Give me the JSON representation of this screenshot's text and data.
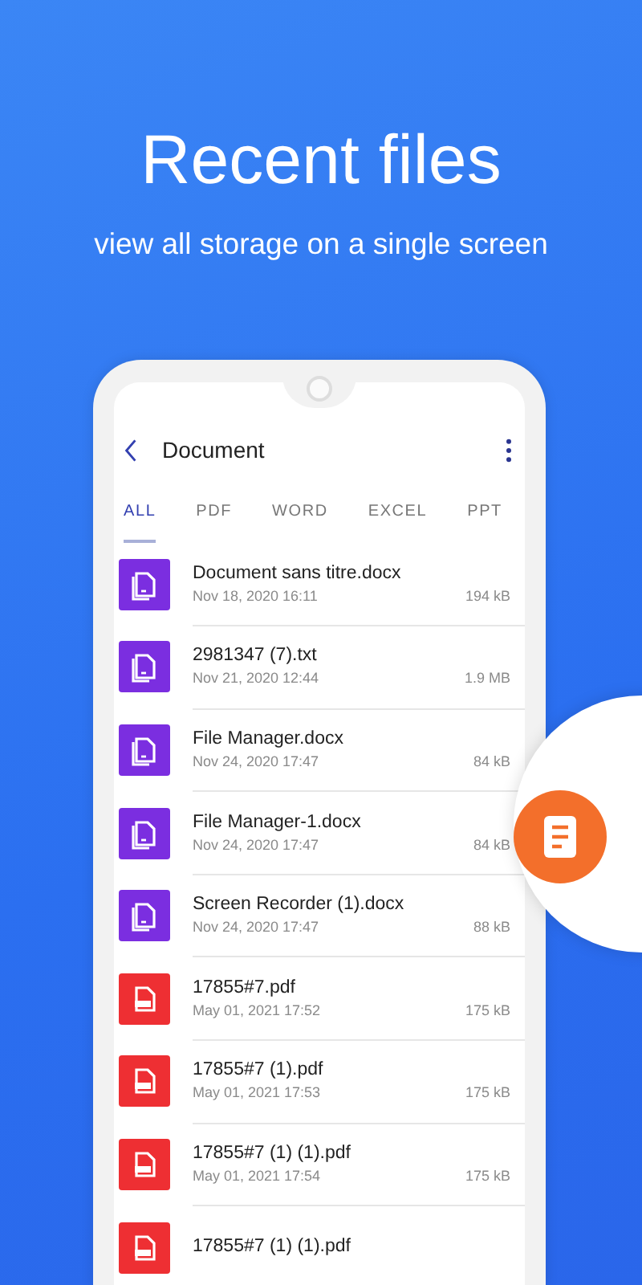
{
  "headline": "Recent files",
  "subtitle": "view all storage on a single screen",
  "header": {
    "title": "Document"
  },
  "tabs": [
    {
      "label": "ALL",
      "selected": true
    },
    {
      "label": "PDF",
      "selected": false
    },
    {
      "label": "WORD",
      "selected": false
    },
    {
      "label": "EXCEL",
      "selected": false
    },
    {
      "label": "PPT",
      "selected": false
    }
  ],
  "files": [
    {
      "kind": "doc",
      "name": "Document sans titre.docx",
      "date": "Nov 18, 2020 16:11",
      "size": "194 kB"
    },
    {
      "kind": "doc",
      "name": "2981347 (7).txt",
      "date": "Nov 21, 2020 12:44",
      "size": "1.9 MB"
    },
    {
      "kind": "doc",
      "name": "File Manager.docx",
      "date": "Nov 24, 2020 17:47",
      "size": "84 kB"
    },
    {
      "kind": "doc",
      "name": "File Manager-1.docx",
      "date": "Nov 24, 2020 17:47",
      "size": "84 kB"
    },
    {
      "kind": "doc",
      "name": "Screen Recorder (1).docx",
      "date": "Nov 24, 2020 17:47",
      "size": "88 kB"
    },
    {
      "kind": "pdf",
      "name": "17855#7.pdf",
      "date": "May 01, 2021 17:52",
      "size": "175 kB"
    },
    {
      "kind": "pdf",
      "name": "17855#7 (1).pdf",
      "date": "May 01, 2021 17:53",
      "size": "175 kB"
    },
    {
      "kind": "pdf",
      "name": "17855#7 (1) (1).pdf",
      "date": "May 01, 2021 17:54",
      "size": "175 kB"
    },
    {
      "kind": "pdf",
      "name": "17855#7 (1) (1).pdf"
    }
  ]
}
